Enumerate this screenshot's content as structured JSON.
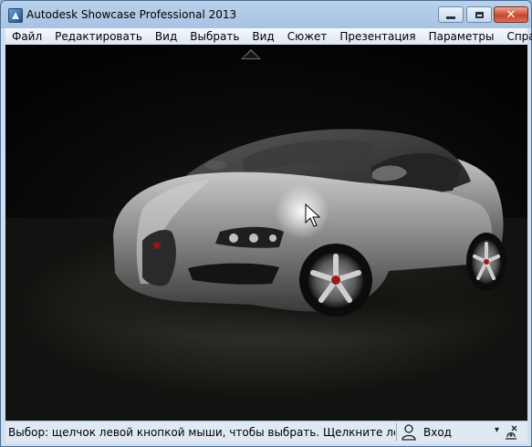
{
  "window": {
    "title": "Autodesk Showcase Professional 2013",
    "close_symbol": "✕"
  },
  "menu": {
    "items": [
      {
        "label": "Файл"
      },
      {
        "label": "Редактировать"
      },
      {
        "label": "Вид"
      },
      {
        "label": "Выбрать"
      },
      {
        "label": "Вид"
      },
      {
        "label": "Сюжет"
      },
      {
        "label": "Презентация"
      },
      {
        "label": "Параметры"
      },
      {
        "label": "Справка"
      }
    ]
  },
  "viewport": {
    "scene": "silver-sports-car-render",
    "panel_toggle_icon": "triangle-up-icon"
  },
  "statusbar": {
    "message": "Выбор: щелчок левой кнопкой мыши, чтобы выбрать. Щелкните левой кнопкой",
    "login_label": "Вход",
    "dropdown_icon": "chevron-down-icon",
    "user_icon": "user-icon",
    "connect_icon": "connection-icon"
  }
}
